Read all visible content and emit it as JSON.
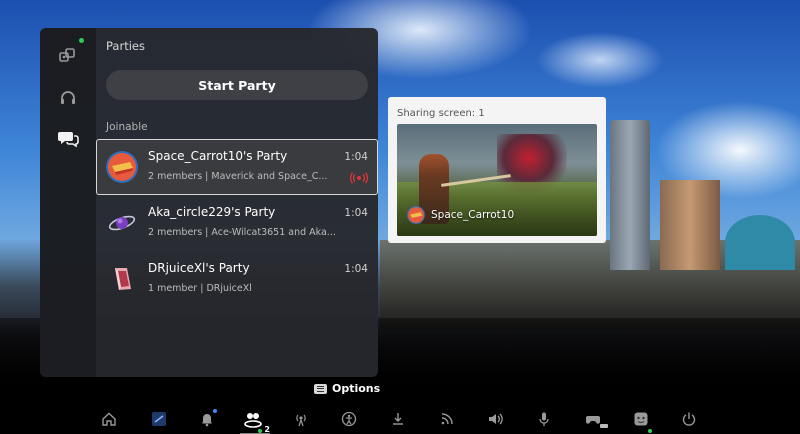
{
  "panel": {
    "title": "Parties",
    "start_party_label": "Start Party",
    "section_label": "Joinable",
    "rail_icons": [
      "game-library-icon",
      "headset-icon",
      "chat-bubbles-icon"
    ]
  },
  "parties": [
    {
      "name": "Space_Carrot10's Party",
      "members": "2 members | Maverick and Space_C...",
      "time": "1:04",
      "selected": true,
      "broadcasting": true
    },
    {
      "name": "Aka_circle229's Party",
      "members": "2 members | Ace-Wilcat3651 and Aka...",
      "time": "1:04",
      "selected": false,
      "broadcasting": false
    },
    {
      "name": "DRjuiceXl's Party",
      "members": "1 member | DRjuiceXl",
      "time": "1:04",
      "selected": false,
      "broadcasting": false
    }
  ],
  "share_preview": {
    "title": "Sharing screen: 1",
    "user": "Space_Carrot10"
  },
  "options_label": "Options",
  "control_center": {
    "icons": [
      "home-icon",
      "game-icon",
      "notifications-icon",
      "game-base-icon",
      "broadcast-icon",
      "accessibility-icon",
      "downloads-icon",
      "network-icon",
      "sound-icon",
      "mic-icon",
      "controller-icon",
      "profile-icon",
      "power-icon"
    ],
    "game_base_badge": "2"
  },
  "colors": {
    "online_dot": "#2ecc52",
    "broadcast_red": "#e0353a"
  }
}
